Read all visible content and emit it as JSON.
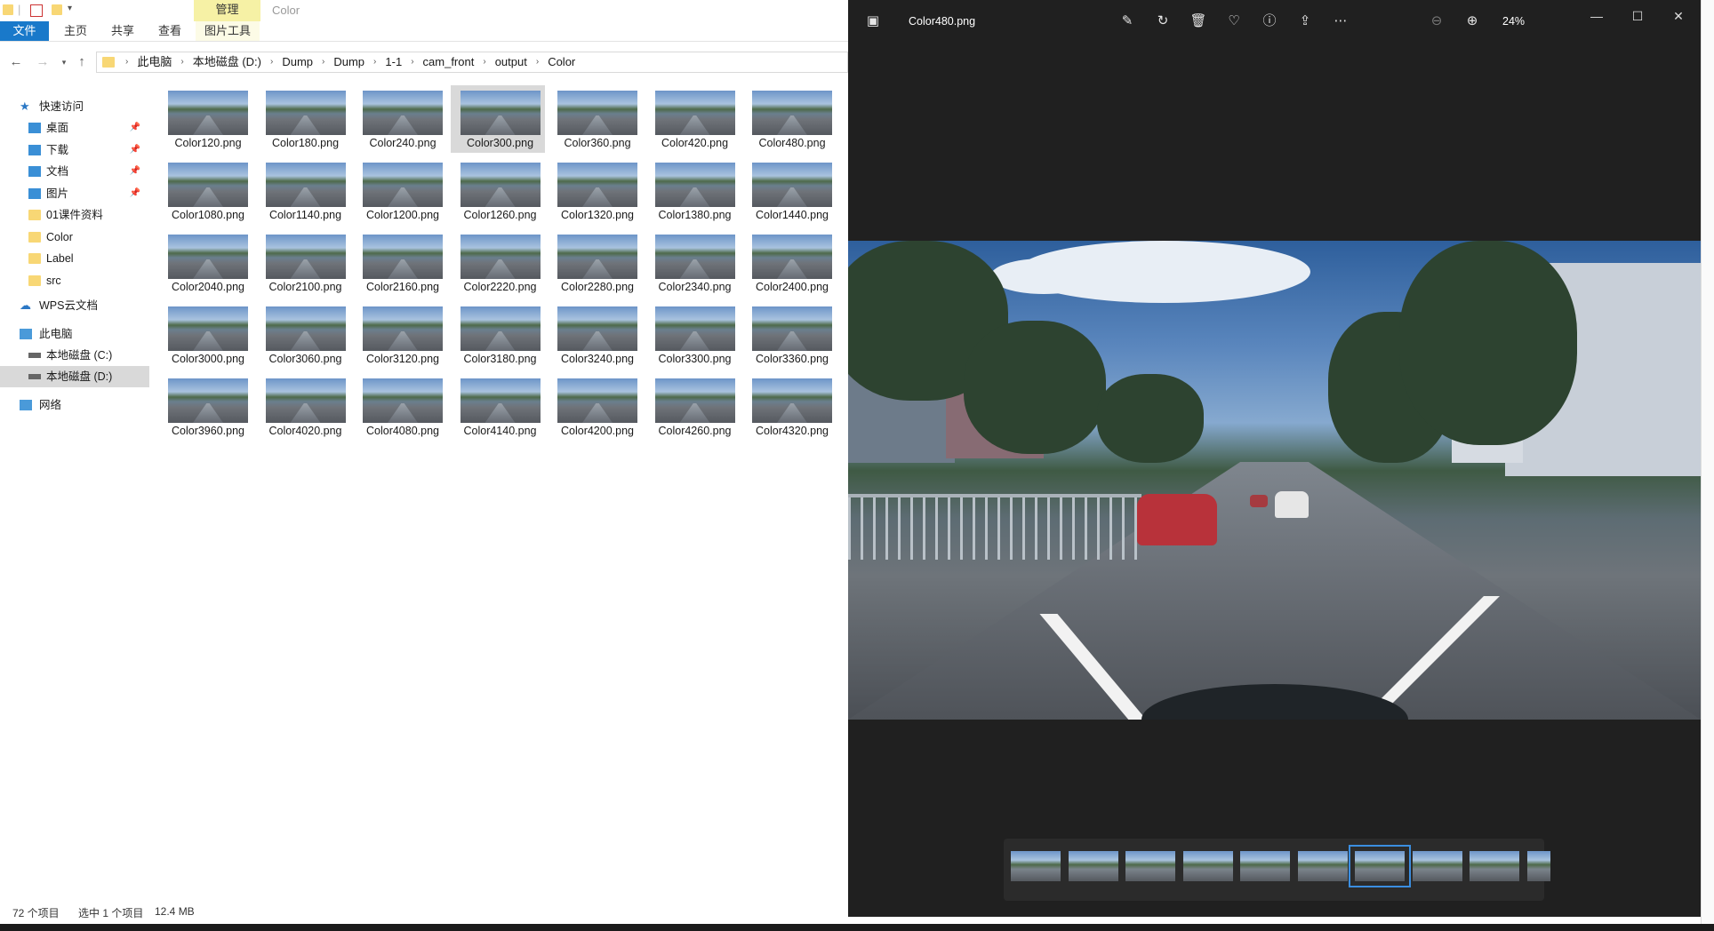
{
  "explorer": {
    "window_title": "Color",
    "context_tab": "管理",
    "ribbon_tabs": [
      "文件",
      "主页",
      "共享",
      "查看",
      "图片工具"
    ],
    "breadcrumbs": [
      "此电脑",
      "本地磁盘 (D:)",
      "Dump",
      "Dump",
      "1-1",
      "cam_front",
      "output",
      "Color"
    ],
    "nav": {
      "quick_access": "快速访问",
      "quick_items": [
        "桌面",
        "下载",
        "文档",
        "图片",
        "01课件资料",
        "Color",
        "Label",
        "src"
      ],
      "wps": "WPS云文档",
      "this_pc": "此电脑",
      "drives": [
        "本地磁盘 (C:)",
        "本地磁盘 (D:)"
      ],
      "network": "网络"
    },
    "files": [
      [
        "Color120.png",
        "Color180.png",
        "Color240.png",
        "Color300.png",
        "Color360.png",
        "Color420.png",
        "Color480.png"
      ],
      [
        "Color1080.png",
        "Color1140.png",
        "Color1200.png",
        "Color1260.png",
        "Color1320.png",
        "Color1380.png",
        "Color1440.png"
      ],
      [
        "Color2040.png",
        "Color2100.png",
        "Color2160.png",
        "Color2220.png",
        "Color2280.png",
        "Color2340.png",
        "Color2400.png"
      ],
      [
        "Color3000.png",
        "Color3060.png",
        "Color3120.png",
        "Color3180.png",
        "Color3240.png",
        "Color3300.png",
        "Color3360.png"
      ],
      [
        "Color3960.png",
        "Color4020.png",
        "Color4080.png",
        "Color4140.png",
        "Color4200.png",
        "Color4260.png",
        "Color4320.png"
      ]
    ],
    "selected_file": "Color300.png",
    "status": {
      "count": "72 个项目",
      "selected": "选中 1 个项目",
      "size": "12.4 MB"
    }
  },
  "viewer": {
    "filename": "Color480.png",
    "zoom": "24%",
    "filmstrip_count": 10,
    "filmstrip_selected_index": 6,
    "icons": [
      "image-icon",
      "edit-icon",
      "rotate-icon",
      "delete-icon",
      "favorite-icon",
      "info-icon",
      "share-icon",
      "more-icon",
      "zoom-out-icon",
      "zoom-in-icon"
    ]
  }
}
